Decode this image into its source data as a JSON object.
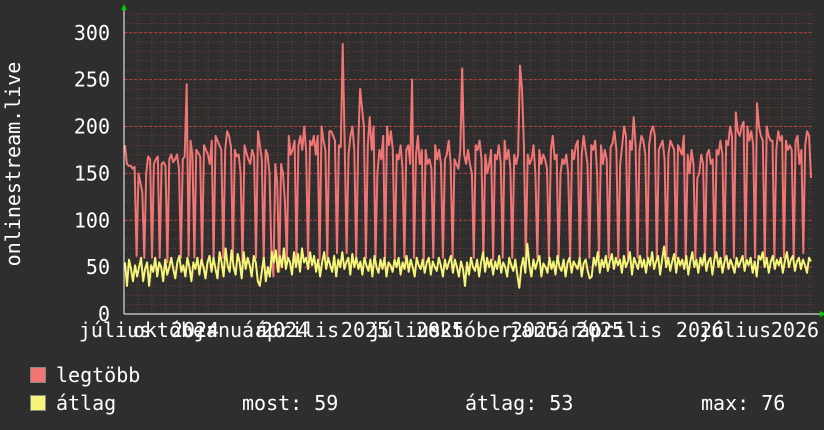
{
  "chart_data": {
    "type": "line",
    "ylabel": "onlinestream.live",
    "ylim": [
      0,
      320
    ],
    "yticks": [
      0,
      50,
      100,
      150,
      200,
      250,
      300
    ],
    "x_tick_labels": [
      "július",
      "október",
      "2024",
      "január",
      "2024",
      "április",
      "2025",
      "július",
      "2025",
      "október",
      "2025",
      "január",
      "2025",
      "április",
      "2026",
      "július",
      "2026"
    ],
    "grid": true,
    "series": [
      {
        "name": "legtöbb",
        "color": "#f07676",
        "values": [
          180,
          160,
          158,
          158,
          155,
          157,
          62,
          150,
          140,
          130,
          60,
          150,
          168,
          165,
          60,
          160,
          165,
          168,
          60,
          160,
          162,
          158,
          55,
          165,
          170,
          162,
          165,
          170,
          155,
          60,
          165,
          168,
          245,
          62,
          185,
          170,
          60,
          175,
          172,
          168,
          55,
          180,
          175,
          170,
          160,
          185,
          58,
          190,
          185,
          180,
          175,
          60,
          175,
          195,
          190,
          178,
          60,
          175,
          168,
          170,
          150,
          55,
          180,
          172,
          165,
          160,
          175,
          168,
          60,
          195,
          180,
          165,
          58,
          175,
          170,
          150,
          65,
          40,
          160,
          140,
          45,
          160,
          150,
          120,
          60,
          190,
          170,
          175,
          185,
          60,
          180,
          190,
          175,
          200,
          175,
          60,
          185,
          180,
          190,
          170,
          190,
          58,
          200,
          185,
          175,
          60,
          195,
          195,
          190,
          185,
          65,
          180,
          178,
          288,
          180,
          65,
          170,
          190,
          200,
          175,
          60,
          180,
          240,
          220,
          200,
          60,
          180,
          210,
          175,
          200,
          60,
          150,
          175,
          165,
          190,
          60,
          200,
          180,
          195,
          175,
          60,
          170,
          165,
          180,
          155,
          60,
          175,
          180,
          160,
          250,
          60,
          170,
          190,
          160,
          175,
          55,
          175,
          160,
          165,
          155,
          60,
          180,
          165,
          175,
          160,
          60,
          165,
          170,
          185,
          160,
          60,
          165,
          160,
          155,
          175,
          262,
          170,
          160,
          175,
          160,
          150,
          60,
          180,
          175,
          185,
          165,
          60,
          170,
          150,
          160,
          175,
          58,
          170,
          165,
          180,
          160,
          60,
          185,
          165,
          175,
          155,
          60,
          170,
          160,
          170,
          265,
          240,
          180,
          60,
          170,
          160,
          165,
          180,
          150,
          60,
          175,
          160,
          170,
          165,
          155,
          60,
          175,
          190,
          165,
          170,
          60,
          150,
          165,
          160,
          170,
          150,
          60,
          175,
          165,
          180,
          185,
          60,
          170,
          190,
          175,
          160,
          60,
          180,
          175,
          185,
          150,
          60,
          180,
          160,
          175,
          165,
          60,
          178,
          182,
          195,
          175,
          60,
          160,
          180,
          200,
          190,
          60,
          185,
          175,
          210,
          180,
          60,
          175,
          190,
          185,
          170,
          60,
          180,
          195,
          200,
          190,
          60,
          175,
          180,
          185,
          165,
          60,
          170,
          185,
          180,
          175,
          60,
          180,
          175,
          170,
          190,
          60,
          170,
          150,
          175,
          160,
          60,
          145,
          150,
          170,
          160,
          60,
          170,
          175,
          160,
          165,
          60,
          175,
          170,
          185,
          170,
          60,
          185,
          180,
          200,
          190,
          60,
          215,
          195,
          190,
          200,
          205,
          60,
          200,
          185,
          195,
          180,
          60,
          225,
          200,
          190,
          185,
          60,
          200,
          190,
          185,
          185,
          60,
          175,
          195,
          185,
          190,
          60,
          185,
          175,
          180,
          175,
          60,
          185,
          190,
          160,
          175,
          65,
          180,
          195,
          190,
          145
        ],
        "values_note_excluded": false
      },
      {
        "name": "átlag",
        "color": "#f5f57a",
        "values": [
          55,
          30,
          58,
          48,
          35,
          52,
          40,
          50,
          60,
          35,
          48,
          55,
          30,
          52,
          45,
          60,
          40,
          55,
          50,
          35,
          58,
          42,
          50,
          60,
          48,
          38,
          55,
          62,
          45,
          52,
          40,
          60,
          50,
          35,
          55,
          48,
          60,
          42,
          58,
          50,
          38,
          55,
          62,
          45,
          60,
          48,
          38,
          66,
          55,
          40,
          70,
          52,
          45,
          68,
          50,
          42,
          64,
          55,
          38,
          66,
          48,
          60,
          52,
          40,
          62,
          55,
          35,
          30,
          45,
          60,
          35,
          50,
          40,
          66,
          55,
          68,
          45,
          62,
          50,
          70,
          48,
          60,
          55,
          42,
          66,
          50,
          64,
          45,
          70,
          55,
          60,
          48,
          66,
          52,
          62,
          45,
          58,
          40,
          55,
          66,
          48,
          60,
          52,
          45,
          62,
          40,
          58,
          50,
          66,
          48,
          55,
          60,
          42,
          64,
          50,
          60,
          48,
          56,
          42,
          60,
          52,
          46,
          58,
          40,
          62,
          50,
          44,
          58,
          48,
          60,
          40,
          55,
          52,
          45,
          58,
          50,
          60,
          42,
          55,
          48,
          62,
          45,
          58,
          50,
          40,
          60,
          52,
          48,
          58,
          44,
          55,
          60,
          42,
          56,
          50,
          46,
          60,
          52,
          40,
          58,
          48,
          55,
          62,
          44,
          58,
          50,
          40,
          56,
          48,
          30,
          55,
          42,
          60,
          50,
          46,
          58,
          40,
          55,
          66,
          45,
          60,
          50,
          58,
          42,
          56,
          48,
          62,
          44,
          55,
          50,
          40,
          60,
          52,
          46,
          58,
          42,
          28,
          50,
          60,
          44,
          75,
          52,
          40,
          58,
          48,
          56,
          62,
          40,
          54,
          50,
          44,
          60,
          48,
          56,
          42,
          62,
          50,
          46,
          58,
          40,
          55,
          60,
          44,
          56,
          52,
          48,
          60,
          40,
          54,
          58,
          46,
          38,
          40,
          60,
          52,
          66,
          44,
          58,
          50,
          62,
          46,
          56,
          64,
          48,
          60,
          52,
          58,
          44,
          62,
          50,
          56,
          66,
          42,
          60,
          54,
          48,
          62,
          50,
          58,
          44,
          60,
          52,
          66,
          48,
          56,
          62,
          42,
          58,
          72,
          50,
          60,
          46,
          56,
          64,
          44,
          60,
          52,
          58,
          48,
          62,
          42,
          56,
          66,
          50,
          58,
          44,
          60,
          52,
          64,
          46,
          56,
          60,
          42,
          58,
          66,
          50,
          60,
          44,
          56,
          62,
          48,
          58,
          52,
          44,
          60,
          50,
          56,
          62,
          46,
          58,
          52,
          60,
          44,
          56,
          40,
          62,
          58,
          66,
          50,
          60,
          44,
          56,
          62,
          48,
          58,
          52,
          60,
          44,
          56,
          66,
          50,
          58,
          62,
          46,
          56,
          60,
          48,
          58,
          52,
          44,
          60,
          56
        ]
      }
    ]
  },
  "legend": {
    "max_label": "legtöbb",
    "avg_label": "átlag",
    "now_text": "most: 59",
    "avg_text": "átlag: 53",
    "max_text": "max: 76"
  },
  "colors": {
    "background": "#2e2e2e",
    "plot_background": "#2e2e2e",
    "grid": "#b84242",
    "axis": "#ffffff",
    "arrow": "#00cc00"
  }
}
